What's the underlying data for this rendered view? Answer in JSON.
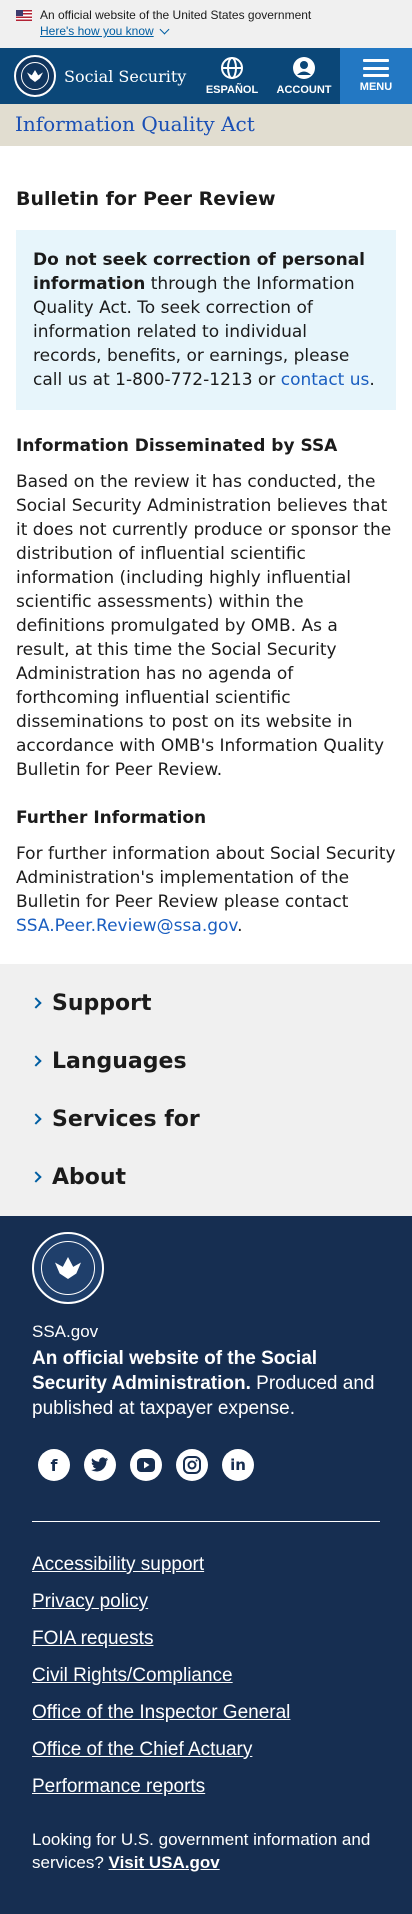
{
  "gov_banner": {
    "text": "An official website of the United States government",
    "link": "Here's how you know"
  },
  "header": {
    "brand": "Social Security",
    "espanol": "ESPAÑOL",
    "account": "ACCOUNT",
    "menu": "MENU"
  },
  "page_title": "Information Quality Act",
  "content": {
    "bulletin_title": "Bulletin for Peer Review",
    "alert_bold": "Do not seek correction of personal information",
    "alert_text": " through the Information Quality Act. To seek correction of information related to individual records, benefits, or earnings, please call us at 1-800-772-1213 or ",
    "alert_link": "contact us",
    "alert_end": ".",
    "section1_title": "Information Disseminated by SSA",
    "section1_body": "Based on the review it has conducted, the Social Security Administration believes that it does not currently produce or sponsor the distribution of influential scientific information (including highly influential scientific assessments) within the definitions promulgated by OMB. As a result, at this time the Social Security Administration has no agenda of forthcoming influential scientific disseminations to post on its website in accordance with OMB's Information Quality Bulletin for Peer Review.",
    "section2_title": "Further Information",
    "section2_body": "For further information about Social Security Administration's implementation of the Bulletin for Peer Review please contact ",
    "section2_link": "SSA.Peer.Review@ssa.gov",
    "section2_end": "."
  },
  "accordions": [
    "Support",
    "Languages",
    "Services for",
    "About"
  ],
  "footer": {
    "site": "SSA.gov",
    "desc_bold": "An official website of the Social Security Administration.",
    "desc_rest": " Produced and published at taxpayer expense.",
    "social": [
      "facebook-icon",
      "twitter-icon",
      "youtube-icon",
      "instagram-icon",
      "linkedin-icon"
    ],
    "links": [
      "Accessibility support",
      "Privacy policy",
      "FOIA requests",
      "Civil Rights/Compliance",
      "Office of the Inspector General",
      "Office of the Chief Actuary",
      "Performance reports"
    ],
    "note_text": "Looking for U.S. government information and services? ",
    "note_link": "Visit USA.gov"
  },
  "colors": {
    "header": "#0b4778",
    "menu": "#2378c3",
    "title_bar": "#e1ddd0",
    "alert_bg": "#e7f5fb",
    "footer": "#162e51",
    "link": "#1a5ec0"
  }
}
